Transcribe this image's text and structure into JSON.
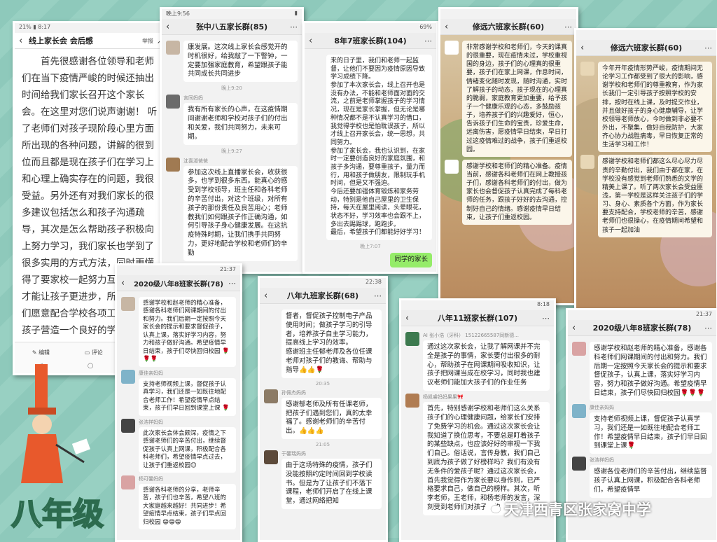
{
  "grade_label": "八年级",
  "watermark": "天津西青区张家窝中学",
  "s1": {
    "status_left": "21% ▮ 8:17",
    "title": "线上家长会 会后感",
    "report": "举报",
    "article": "首先很感谢各位领导和老师们在当下疫情严峻的时候还抽出时间给我们家长召开这个家长会。在这里对您们说声谢谢！ 听了老师们对孩子现阶段心里方面所出现的各种问题，讲解的很到位而且都是现在孩子们在学习上和心理上确实存在的问题，我很受益。另外还有对我们家长的很多建议包括怎么和孩子沟通疏导，其次是怎么帮助孩子积极向上努力学习，我们家长也学到了很多实用的方式方法，同时更懂得了要家校一起努力互相配合，才能让孩子更进步，所以今后我们愿意配合学校各项工作共同为孩子营造一个良好的学习氛围，同时积极参与",
    "actions": [
      "编辑",
      "评论",
      "动"
    ]
  },
  "s2": {
    "status": "晚上9:56",
    "title": "张中八五家长群(85)",
    "msg1": "康发展。这次线上家长会感觉开的时机很好，给我敲了一下警钟，一定要加强家庭教育，希望跟孩子能共同成长共同进步",
    "time1": "晚上9:20",
    "sender2": "言同妈妈",
    "msg2": "我有所有家长的心声，在这疫情期间谢谢老师和学校对孩子们的付出和关爱，我们共同努力，未来可期。",
    "time2": "晚上9:27",
    "sender3": "沈喜淑爸爸",
    "msg3": "参加这次线上直播家长会，收获很多，也学到很多东西。能真心的感受到学校领导，班主任和各科老师的辛苦付出，对这个班级，对所有孩子的那份责任及良苦用心；老师教我们如何跟孩子作正确沟通，如何引导孩子身心健康发展。在这抗疫特殊时期，让我们携手共同努力，更好地配合学校和老师们的辛勤"
  },
  "s3": {
    "status": "69%",
    "title": "8年7班家长群(104)",
    "msg": "来的日子里，我们和老师一起监督，让他们不要因为疫情原因导致学习成绩下降。\n参加了本次家长会，线上召开也是没有办法，不能和老师面对面的交流，之前是老师掌握孩子的学习情况，现在是家长掌握，但无论是哪种情况都不是不认真学习的借口，我觉得学校也是怕耽误孩子，所以才线上召开家长会，统一思想，共同努力。\n参加了家长会，我也认识到，在家时一定要创造良好的家庭氛围，和孩子多沟通，要尊重孩子，量力而行，用和孩子做朋友，限制玩手机时间，但是又不强迫。\n今后还要加强体育锻炼和家务劳动，特别是他自己屋里的卫生保持，每天在屋里阅读，头晕眼花，状态不好，学习效率也会跟不上，多出去踢踢球，跑跑步。\n最后，希望孩子们都能好好学习！",
    "time": "晚上7:07",
    "green": "同学的家长"
  },
  "s4": {
    "title": "修远六班家长群(60)",
    "msg1": "非常感谢学校和老师们，今天的课真的很重要，现在疫情未过，学校重视国的身边，孩子们的心理真的很重要，孩子们在家上网课，作息时间，情绪变化随时发现，随时沟通，实时了解孩子的动态，孩子现在的心理真的脆弱，家庭教育更加重要，给予孩子一个健康乐观的心态，多鼓励孩子，培养孩子们的兴趣爱好，恒心，告诉孩子们生命的宝贵，珍爱生命，远离伤害，愿疫情早日结束，早日打过这疫情难过的战争，孩子们重返校园。",
    "msg2": "感谢学校和老师们的精心准备。疫情当前，感谢各科老师们在网上教授孩子们，感谢各科老师们的付出，做为家长也会督促孩子认真完成了每科老师的任务，跟孩子好好的去沟通，控制好自己的情绪。感谢疫情早日结束，让孩子们重返校园。"
  },
  "s5": {
    "title": "修远六班家长群(60)",
    "msg1": "今年开年疫情形势严峻，疫情期间无论学习工作都受到了很大的影响，感谢学校和老师们的尊重教育，作为家长我们一定引导孩子按照学校的安排，按时在线上课，及时提交作业，并且做好孩子的身心健康辅导，让学校领导老师放心，今时做到非必要不外出，不聚集，做好自我防护，大家齐心协力战胜病毒，早日恢复正常的生活学习和工作！",
    "msg2": "感谢学校和老师们都这么尽心尽力尽责的辛勤付出，我们由于都在家，在学校没有感觉到老师们熟悉的文学的精美上课了。听了两次家长会受益匪浅，第一学校是这样关注孩子们的学习、身心、素质各个方面，作为家长要支持配合，学校老师的辛苦，感谢老师们也很操心，在疫情期间希望和孩子一起加油"
  },
  "s6": {
    "status": "21:37",
    "title": "2020级八年8班家长群(78)",
    "msg1": "感谢学校和赵老师的精心准备，感谢各科老师们网课期间的付出和努力。我们后期一定按照今天家长会的提示和要求督促孩子，认真上课，落实好学习内容，努力和孩子做好沟通。希望疫情早日结束，孩子们尽快回归校园 🌹🌹🌹",
    "sender2": "康佳亲妈妈",
    "msg2": "支持老师视频上课，督促孩子认真学习，我们还是一如既往地配合老师工作！希望疫情早点结束，孩子们早日回到课堂上课 🌹",
    "sender3": "张浩祥妈妈",
    "msg3": "此次家长会体会颇深，疫情之下感谢老师们的辛苦付出，继续督促孩子认真上网课，积极配合各科老师们，希望疫情早点过去，让孩子们重返校园😊",
    "sender4": "杨可馨妈妈",
    "msg4": "感谢各科老师的分享，老师辛苦，孩子们也辛苦，希望八班的大家庭越来越好！共同进步！希望疫情早点结束，孩子们早点回归校园 😁😁😁"
  },
  "s7": {
    "status": "22:38",
    "title": "八年九班家长群(68)",
    "msg1": "督者，督促孩子控制电子产品使用时间；做孩子学习的引导者，培养孩子自主学习能力，提高线上学习的效率。\n感谢班主任郁老师及各位任课老师对孩子们的教诲、帮助与指导👍👍🌹",
    "time1": "20:35",
    "sender2": "孙佩杰妈妈",
    "msg2": "感谢郁老师及所有任课老师，把孩子们遇到您们，真的太幸福了。感谢老师们的辛苦付出。👍👍👍",
    "time2": "21:05",
    "sender3": "于馨瑞妈妈",
    "msg3": "由于这场特殊的疫情，孩子们没能按照约定时间回到学校读书。但是为了让孩子们不落下课程，老师们开启了在线上课堂，通过网络把知"
  },
  "s8": {
    "status": "8:18",
    "title": "八年11班家长群(107)",
    "sender1": "AI 张小浩（牙科） 15122665587同新德...",
    "msg1": "通过这次家长会，让我了解网课并不完全是孩子的事情，家长要付出很多的耐心，帮助孩子在网课期间吸收知识，让孩子把网课当成在校学习，同时我也建议老师们能加大孩子们的作业任务",
    "sender2": "杨凯睿妈妈果果🎀",
    "msg2": "首先，特别感谢学校和老师们这么关系孩子们的心理健康问题，给家长们安排了免费学习的机会。通过这次家长会让我知道了换位思考，不要总是盯着孩子的某些缺点，也应该好好的审视一下我们自己。俗话说，言传身教，我们自己到底为孩子做了好榜样吗？我们有没有无条件的爱孩子呢？通过这次家长会，首先我觉得作为家长要以身作则，已严格要求自己，做自己的榜样。其次，听李老师，王老师，和杨老师的发言，深刻受到老师们对孩子们的"
  },
  "s9": {
    "status": "21:37",
    "title": "2020级八年8班家长群(78)",
    "msg1": "感谢学校和赵老师的精心准备，感谢各科老师们网课期间的付出和努力。我们后期一定按照今天家长会的提示和要求督促孩子，认真上课，落实好学习内容，努力和孩子做好沟通。希望疫情早日结束，孩子们尽快回归校园🌹🌹🌹",
    "sender2": "康佳亲妈妈",
    "msg2": "支持老师视频上课，督促孩子认真学习，我们还是一如既往地配合老师工作！希望疫情早日结束，孩子们早日回到课堂上课🌹",
    "sender3": "张浩祥妈妈",
    "msg3": "感谢各位老师们的辛苦付出，继续监督孩子认真上网课，积极配合各科老师们，希望疫情早"
  }
}
